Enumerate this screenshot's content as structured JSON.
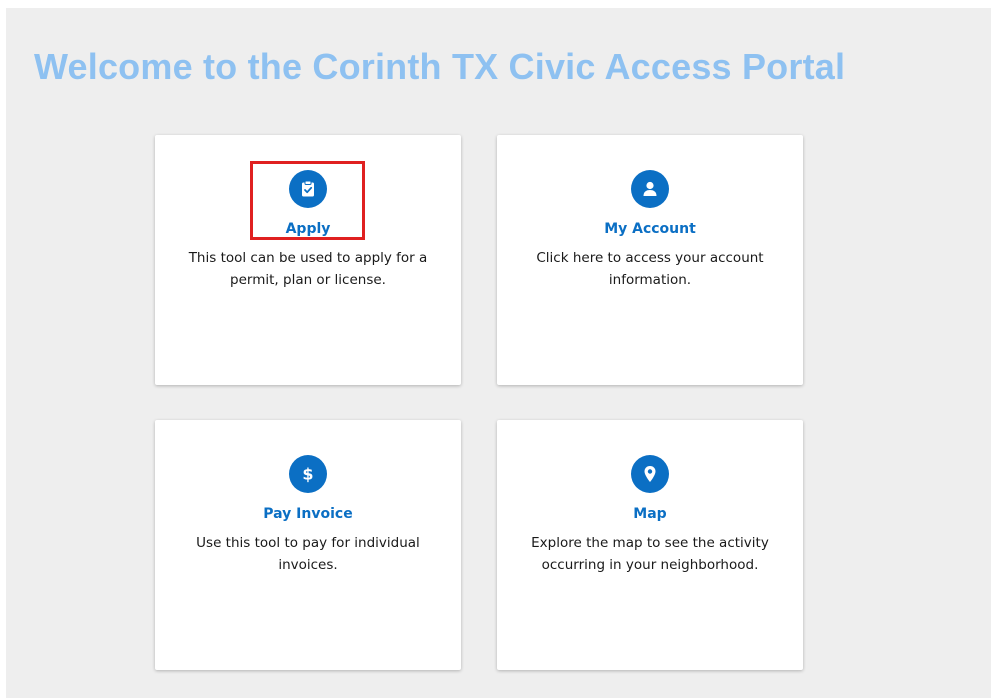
{
  "header": {
    "title": "Welcome to the Corinth TX Civic Access Portal"
  },
  "tiles": [
    {
      "title": "Apply",
      "description": "This tool can be used to apply for a permit, plan or license.",
      "icon": "clipboard-check-icon"
    },
    {
      "title": "My Account",
      "description": "Click here to access your account information.",
      "icon": "user-icon"
    },
    {
      "title": "Pay Invoice",
      "description": "Use this tool to pay for individual invoices.",
      "icon": "dollar-icon"
    },
    {
      "title": "Map",
      "description": "Explore the map to see the activity occurring in your neighborhood.",
      "icon": "map-pin-icon"
    }
  ],
  "colors": {
    "title": "#8ec1f1",
    "accent": "#0b6fc4",
    "panel_background": "#eeeeee",
    "highlight": "#e02020"
  }
}
